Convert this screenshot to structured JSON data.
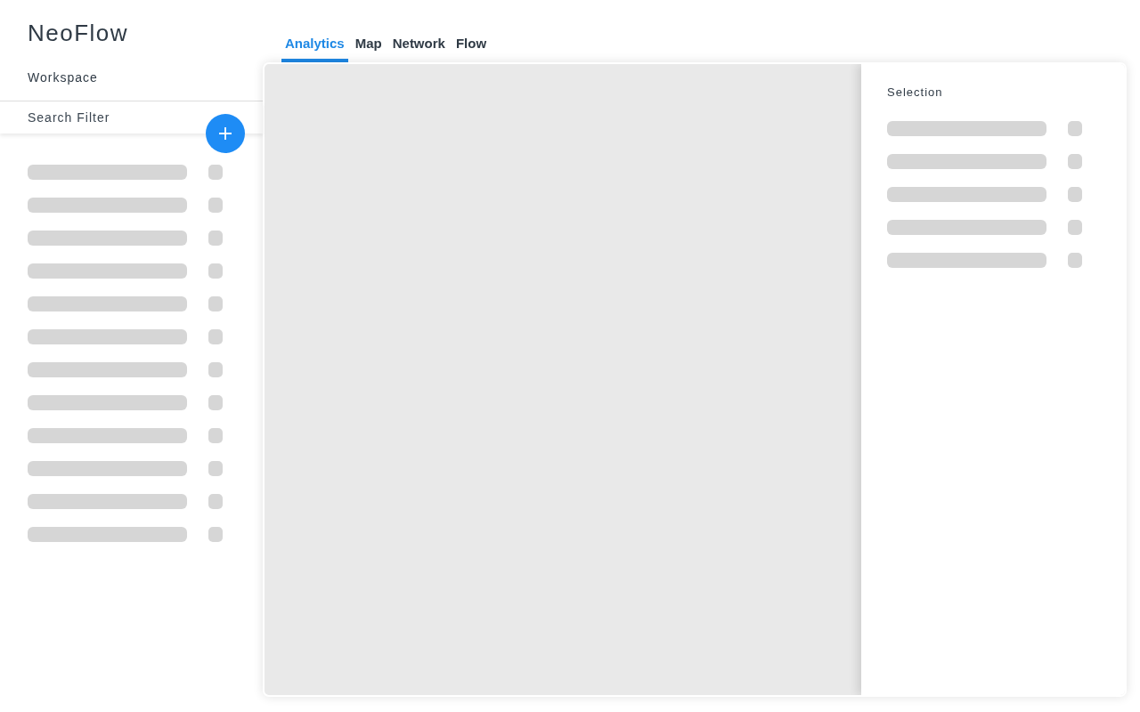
{
  "logo": "NeoFlow",
  "sidebar": {
    "heading": "Workspace",
    "search": {
      "placeholder": "Search Filter"
    }
  },
  "tabs": [
    {
      "label": "Analytics",
      "selected": true
    },
    {
      "label": "Map",
      "selected": false
    },
    {
      "label": "Network",
      "selected": false
    },
    {
      "label": "Flow",
      "selected": false
    }
  ],
  "selection_panel": {
    "title": "Selection"
  }
}
